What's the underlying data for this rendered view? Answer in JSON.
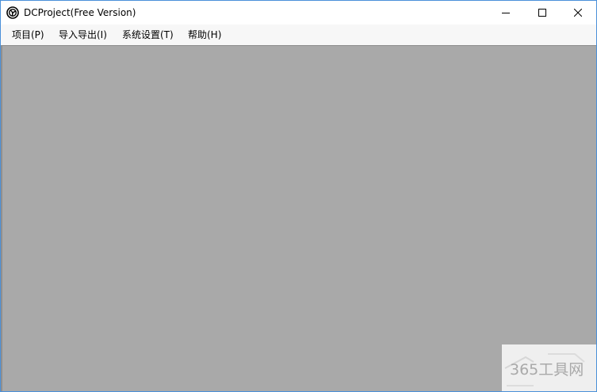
{
  "window": {
    "title": "DCProject(Free Version)",
    "icon": "app-gear-icon",
    "accent_border": "#4a90d9"
  },
  "controls": {
    "minimize_icon": "minimize-icon",
    "maximize_icon": "maximize-icon",
    "close_icon": "close-icon"
  },
  "menu": {
    "items": [
      {
        "label": "项目(P)"
      },
      {
        "label": "导入导出(I)"
      },
      {
        "label": "系统设置(T)"
      },
      {
        "label": "帮助(H)"
      }
    ]
  },
  "client": {
    "background": "#a9a9a9"
  },
  "watermark": {
    "text": "365工具网"
  }
}
